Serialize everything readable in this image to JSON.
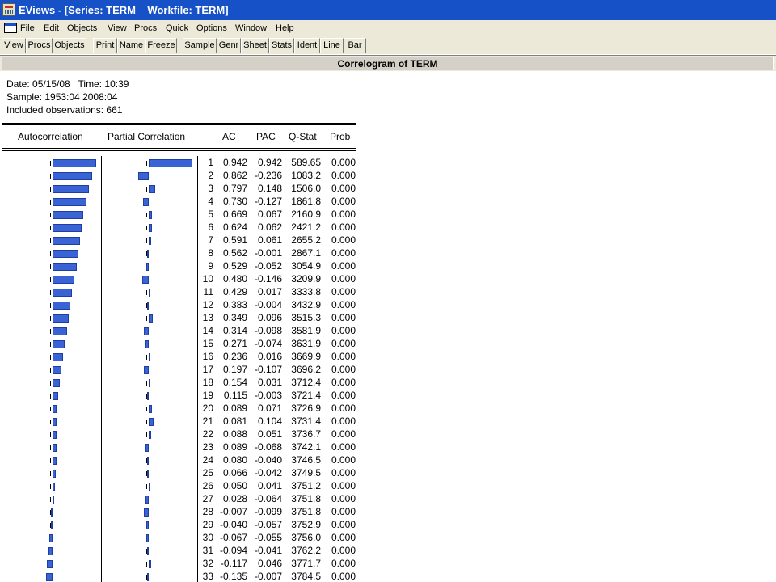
{
  "window": {
    "title": "EViews - [Series: TERM    Workfile: TERM]",
    "app_icon": "eviews-app-icon",
    "doc_icon": "document-window-icon"
  },
  "menu": [
    "File",
    "Edit",
    "Objects",
    "View",
    "Procs",
    "Quick",
    "Options",
    "Window",
    "Help"
  ],
  "toolbar": [
    "View",
    "Procs",
    "Objects",
    "Print",
    "Name",
    "Freeze",
    "Sample",
    "Genr",
    "Sheet",
    "Stats",
    "Ident",
    "Line",
    "Bar"
  ],
  "page_title": "Correlogram of TERM",
  "info": {
    "date_line": "Date: 05/15/08   Time: 10:39",
    "sample_line": "Sample: 1953:04 2008:04",
    "obs_line": "Included observations: 661"
  },
  "columns": {
    "autocorrelation": "Autocorrelation",
    "partial": "Partial Correlation",
    "ac": "AC",
    "pac": "PAC",
    "qstat": "Q-Stat",
    "prob": "Prob"
  },
  "colors": {
    "bar": "#3a63d5",
    "title_bar": "#1651c8",
    "chrome": "#ece9d8"
  },
  "chart_data": {
    "type": "table",
    "title": "Correlogram of TERM",
    "columns": [
      "",
      "AC",
      "PAC",
      "Q-Stat",
      "Prob"
    ],
    "lags": [
      1,
      2,
      3,
      4,
      5,
      6,
      7,
      8,
      9,
      10,
      11,
      12,
      13,
      14,
      15,
      16,
      17,
      18,
      19,
      20,
      21,
      22,
      23,
      24,
      25,
      26,
      27,
      28,
      29,
      30,
      31,
      32,
      33
    ],
    "ac": [
      "0.942",
      "0.862",
      "0.797",
      "0.730",
      "0.669",
      "0.624",
      "0.591",
      "0.562",
      "0.529",
      "0.480",
      "0.429",
      "0.383",
      "0.349",
      "0.314",
      "0.271",
      "0.236",
      "0.197",
      "0.154",
      "0.115",
      "0.089",
      "0.081",
      "0.088",
      "0.089",
      "0.080",
      "0.066",
      "0.050",
      "0.028",
      "-0.007",
      "-0.040",
      "-0.067",
      "-0.094",
      "-0.117",
      "-0.135"
    ],
    "pac": [
      "0.942",
      "-0.236",
      "0.148",
      "-0.127",
      "0.067",
      "0.062",
      "0.061",
      "-0.001",
      "-0.052",
      "-0.146",
      "0.017",
      "-0.004",
      "0.096",
      "-0.098",
      "-0.074",
      "0.016",
      "-0.107",
      "0.031",
      "-0.003",
      "0.071",
      "0.104",
      "0.051",
      "-0.068",
      "-0.040",
      "-0.042",
      "0.041",
      "-0.064",
      "-0.099",
      "-0.057",
      "-0.055",
      "-0.041",
      "0.046",
      "-0.007"
    ],
    "qstat": [
      "589.65",
      "1083.2",
      "1506.0",
      "1861.8",
      "2160.9",
      "2421.2",
      "2655.2",
      "2867.1",
      "3054.9",
      "3209.9",
      "3333.8",
      "3432.9",
      "3515.3",
      "3581.9",
      "3631.9",
      "3669.9",
      "3696.2",
      "3712.4",
      "3721.4",
      "3726.9",
      "3731.4",
      "3736.7",
      "3742.1",
      "3746.5",
      "3749.5",
      "3751.2",
      "3751.8",
      "3751.8",
      "3752.9",
      "3756.0",
      "3762.2",
      "3771.7",
      "3784.5"
    ],
    "prob": [
      "0.000",
      "0.000",
      "0.000",
      "0.000",
      "0.000",
      "0.000",
      "0.000",
      "0.000",
      "0.000",
      "0.000",
      "0.000",
      "0.000",
      "0.000",
      "0.000",
      "0.000",
      "0.000",
      "0.000",
      "0.000",
      "0.000",
      "0.000",
      "0.000",
      "0.000",
      "0.000",
      "0.000",
      "0.000",
      "0.000",
      "0.000",
      "0.000",
      "0.000",
      "0.000",
      "0.000",
      "0.000",
      "0.000"
    ]
  }
}
